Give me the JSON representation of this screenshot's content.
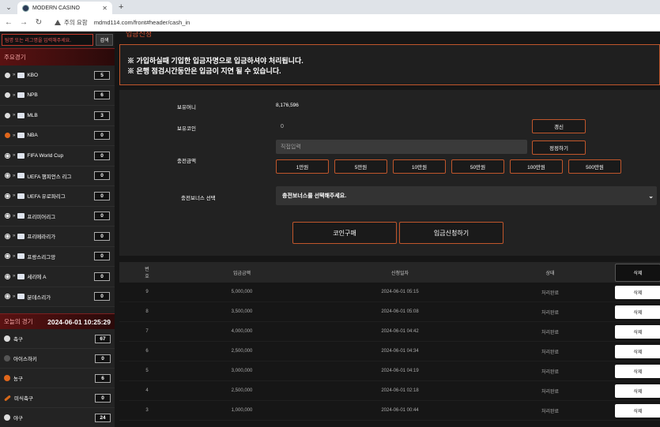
{
  "browser": {
    "tab_title": "MODERN CASINO",
    "insecure_label": "주의 요함",
    "url": "mdmd114.com/front#header/cash_in"
  },
  "sidebar": {
    "search_placeholder": "팀명 또는 리그명을 입력해주세요.",
    "search_button": "검색",
    "main_games_title": "주요경기",
    "leagues": [
      {
        "name": "KBO",
        "count": "5",
        "ball": "baseball"
      },
      {
        "name": "NPB",
        "count": "6",
        "ball": "baseball"
      },
      {
        "name": "MLB",
        "count": "3",
        "ball": "baseball"
      },
      {
        "name": "NBA",
        "count": "0",
        "ball": "basketball"
      },
      {
        "name": "FIFA World Cup",
        "count": "0",
        "ball": "soccer"
      },
      {
        "name": "UEFA 챔피언스 리그",
        "count": "0",
        "ball": "soccer"
      },
      {
        "name": "UEFA 유로파리그",
        "count": "0",
        "ball": "soccer"
      },
      {
        "name": "프리미어리그",
        "count": "0",
        "ball": "soccer"
      },
      {
        "name": "프리메라리가",
        "count": "0",
        "ball": "soccer"
      },
      {
        "name": "프랑스리그앙",
        "count": "0",
        "ball": "soccer"
      },
      {
        "name": "세리에 A",
        "count": "0",
        "ball": "soccer"
      },
      {
        "name": "분데스리가",
        "count": "0",
        "ball": "soccer"
      }
    ],
    "today_title": "오늘의 경기",
    "today_clock": "2024-06-01 10:25:29",
    "sports": [
      {
        "name": "축구",
        "count": "67"
      },
      {
        "name": "아이스하키",
        "count": "0"
      },
      {
        "name": "농구",
        "count": "6"
      },
      {
        "name": "미식축구",
        "count": "0"
      },
      {
        "name": "야구",
        "count": "24"
      }
    ]
  },
  "main": {
    "page_title": "입금신청",
    "notice_lines": [
      "※ 가입하실때 기입한 입금자명으로 입금하셔야 처리됩니다.",
      "※ 은행 점검시간동안은 입금이 지연 될 수 있습니다."
    ],
    "form": {
      "money_label": "보유머니",
      "money_value": "8,176,596",
      "coin_label": "보유코인",
      "coin_value": "0",
      "refresh_button": "갱신",
      "charge_label": "충전금액",
      "direct_placeholder": "직접입력",
      "reset_button": "정정하기",
      "amounts": [
        "1만원",
        "5만원",
        "10만원",
        "50만원",
        "100만원",
        "500만원"
      ],
      "bonus_label": "충전보너스 선택",
      "bonus_select": "충전보너스를 선택해주세요.",
      "buy_coin_button": "코인구매",
      "apply_button": "입금신청하기"
    },
    "table": {
      "headers": [
        "번호",
        "입금금액",
        "신청일자",
        "상태",
        "삭제"
      ],
      "rows": [
        {
          "no": "9",
          "amount": "5,000,000",
          "date": "2024-06-01 05:15",
          "status": "처리완료",
          "del": "삭제"
        },
        {
          "no": "8",
          "amount": "3,500,000",
          "date": "2024-06-01 05:08",
          "status": "처리완료",
          "del": "삭제"
        },
        {
          "no": "7",
          "amount": "4,000,000",
          "date": "2024-06-01 04:42",
          "status": "처리완료",
          "del": "삭제"
        },
        {
          "no": "6",
          "amount": "2,500,000",
          "date": "2024-06-01 04:34",
          "status": "처리완료",
          "del": "삭제"
        },
        {
          "no": "5",
          "amount": "3,000,000",
          "date": "2024-06-01 04:19",
          "status": "처리완료",
          "del": "삭제"
        },
        {
          "no": "4",
          "amount": "2,500,000",
          "date": "2024-06-01 02:18",
          "status": "처리완료",
          "del": "삭제"
        },
        {
          "no": "3",
          "amount": "1,000,000",
          "date": "2024-06-01 00:44",
          "status": "처리완료",
          "del": "삭제"
        }
      ]
    }
  }
}
